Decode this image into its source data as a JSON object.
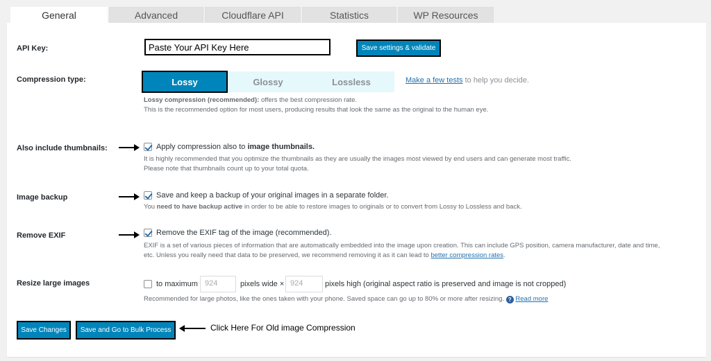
{
  "tabs": [
    {
      "label": "General",
      "active": true
    },
    {
      "label": "Advanced"
    },
    {
      "label": "Cloudflare API"
    },
    {
      "label": "Statistics"
    },
    {
      "label": "WP Resources"
    }
  ],
  "api_key": {
    "label": "API Key:",
    "value": "Paste Your API Key Here",
    "button": "Save settings & validate"
  },
  "compression": {
    "label": "Compression type:",
    "options": [
      "Lossy",
      "Glossy",
      "Lossless"
    ],
    "selected": "Lossy",
    "tests_link": "Make a few tests",
    "tests_suffix": "to help you decide.",
    "desc_bold": "Lossy compression (recommended):",
    "desc_rest": "offers the best compression rate.",
    "desc_line2": "This is the recommended option for most users, producing results that look the same as the original to the human eye."
  },
  "thumbnails": {
    "label": "Also include thumbnails:",
    "checked": true,
    "text_prefix": "Apply compression also to",
    "text_bold": "image thumbnails.",
    "help1": "It is highly recommended that you optimize the thumbnails as they are usually the images most viewed by end users and can generate most traffic.",
    "help2": "Please note that thumbnails count up to your total quota."
  },
  "backup": {
    "label": "Image backup",
    "checked": true,
    "text": "Save and keep a backup of your original images in a separate folder.",
    "help_prefix": "You",
    "help_bold": "need to have backup active",
    "help_rest": "in order to be able to restore images to originals or to convert from Lossy to Lossless and back."
  },
  "exif": {
    "label": "Remove EXIF",
    "checked": true,
    "text": "Remove the EXIF tag of the image (recommended).",
    "help1": "EXIF is a set of various pieces of information that are automatically embedded into the image upon creation. This can include GPS position, camera manufacturer, date and time,",
    "help2_prefix": "etc. Unless you really need that data to be preserved, we recommend removing it as it can lead to",
    "help2_link": "better compression rates",
    "help2_suffix": "."
  },
  "resize": {
    "label": "Resize large images",
    "checked": false,
    "to_max": "to maximum",
    "width_placeholder": "924",
    "wide_text": "pixels wide ×",
    "height_placeholder": "924",
    "high_text": "pixels high (original aspect ratio is preserved and image is not cropped)",
    "help": "Recommended for large photos, like the ones taken with your phone. Saved space can go up to 80% or more after resizing.",
    "help_icon": "?",
    "read_more": "Read more"
  },
  "actions": {
    "save": "Save Changes",
    "bulk": "Save and Go to Bulk Process",
    "annotation": "Click Here For Old image Compression"
  },
  "colors": {
    "accent": "#0085ba",
    "link": "#2271b1",
    "selected_bg": "#e5f8fb"
  }
}
